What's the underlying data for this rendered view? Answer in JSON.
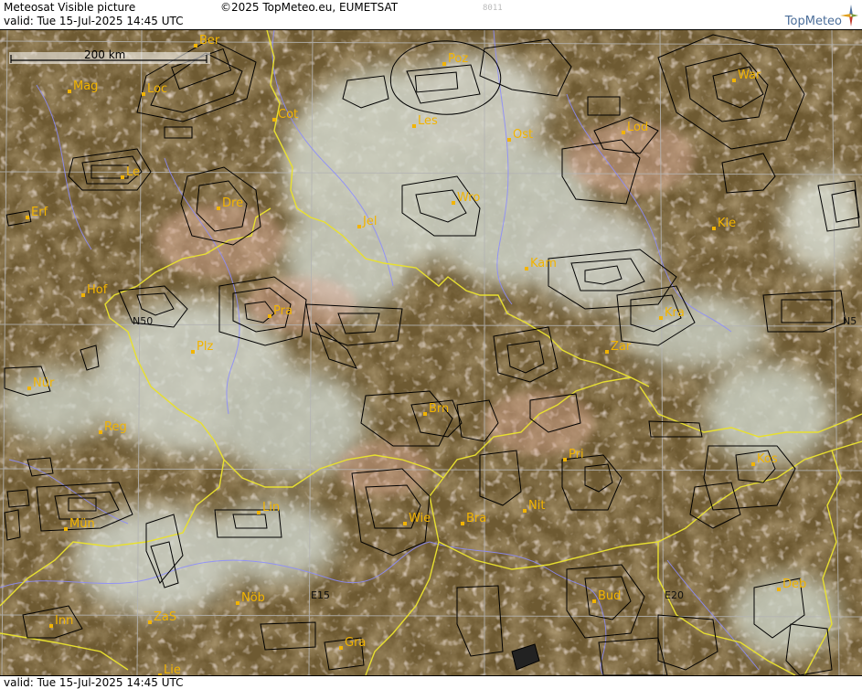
{
  "header": {
    "title": "Meteosat Visible picture",
    "copyright": "©2025 TopMeteo.eu, EUMETSAT",
    "valid": "valid:  Tue  15-Jul-2025  14:45 UTC",
    "image_id": "8011",
    "logo_text": "TopMeteo"
  },
  "footer": {
    "valid": "valid:  Tue  15-Jul-2025  14:45 UTC"
  },
  "map": {
    "scale_label": "200 km",
    "coordinate_labels": {
      "n50_left": "N50",
      "n50_right": "N5",
      "e15": "E15",
      "e20": "E20"
    },
    "cities": [
      {
        "name": "Ber"
      },
      {
        "name": "Poz"
      },
      {
        "name": "War"
      },
      {
        "name": "Mag"
      },
      {
        "name": "Loc"
      },
      {
        "name": "Cot"
      },
      {
        "name": "Les"
      },
      {
        "name": "Lod"
      },
      {
        "name": "Ost"
      },
      {
        "name": "Le"
      },
      {
        "name": "Dre"
      },
      {
        "name": "Wro"
      },
      {
        "name": "Erf"
      },
      {
        "name": "Jel"
      },
      {
        "name": "Kie"
      },
      {
        "name": "Kam"
      },
      {
        "name": "Hof"
      },
      {
        "name": "Pra"
      },
      {
        "name": "Kra"
      },
      {
        "name": "Plz"
      },
      {
        "name": "Zar"
      },
      {
        "name": "Nür"
      },
      {
        "name": "Brn"
      },
      {
        "name": "Reg"
      },
      {
        "name": "Pri"
      },
      {
        "name": "Kos"
      },
      {
        "name": "Lin"
      },
      {
        "name": "Nit"
      },
      {
        "name": "Mün"
      },
      {
        "name": "Wie"
      },
      {
        "name": "Bra"
      },
      {
        "name": "Nöb"
      },
      {
        "name": "Bud"
      },
      {
        "name": "Deb"
      },
      {
        "name": "Inn"
      },
      {
        "name": "ZaS"
      },
      {
        "name": "Gra"
      },
      {
        "name": "Lie"
      }
    ],
    "colors": {
      "border": "#e8e030",
      "river": "#8c8cff",
      "grid": "#b4b4b4",
      "city": "#f2b400",
      "outline": "#000000"
    }
  }
}
